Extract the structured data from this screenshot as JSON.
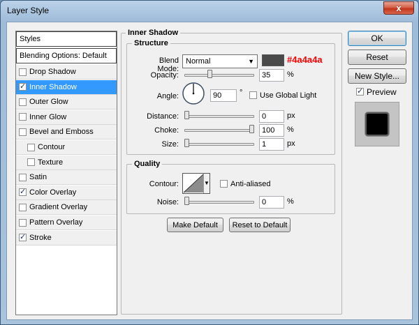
{
  "window": {
    "title": "Layer Style",
    "close_glyph": "x"
  },
  "styles_list": {
    "header": "Styles",
    "blending_options": "Blending Options: Default",
    "items": [
      {
        "label": "Drop Shadow",
        "checked": false,
        "selected": false,
        "indent": false
      },
      {
        "label": "Inner Shadow",
        "checked": true,
        "selected": true,
        "indent": false
      },
      {
        "label": "Outer Glow",
        "checked": false,
        "selected": false,
        "indent": false
      },
      {
        "label": "Inner Glow",
        "checked": false,
        "selected": false,
        "indent": false
      },
      {
        "label": "Bevel and Emboss",
        "checked": false,
        "selected": false,
        "indent": false
      },
      {
        "label": "Contour",
        "checked": false,
        "selected": false,
        "indent": true
      },
      {
        "label": "Texture",
        "checked": false,
        "selected": false,
        "indent": true
      },
      {
        "label": "Satin",
        "checked": false,
        "selected": false,
        "indent": false
      },
      {
        "label": "Color Overlay",
        "checked": true,
        "selected": false,
        "indent": false
      },
      {
        "label": "Gradient Overlay",
        "checked": false,
        "selected": false,
        "indent": false
      },
      {
        "label": "Pattern Overlay",
        "checked": false,
        "selected": false,
        "indent": false
      },
      {
        "label": "Stroke",
        "checked": true,
        "selected": false,
        "indent": false
      }
    ]
  },
  "inner_shadow": {
    "title": "Inner Shadow",
    "structure": {
      "title": "Structure",
      "blend_mode_label": "Blend Mode:",
      "blend_mode_value": "Normal",
      "color_swatch": "#4a4a4a",
      "color_annotation": "#4a4a4a",
      "opacity_label": "Opacity:",
      "opacity_value": "35",
      "opacity_fraction": 0.35,
      "opacity_unit": "%",
      "angle_label": "Angle:",
      "angle_value": "90",
      "angle_unit": "°",
      "use_global_light_label": "Use Global Light",
      "use_global_light_checked": false,
      "distance_label": "Distance:",
      "distance_value": "0",
      "distance_fraction": 0,
      "distance_unit": "px",
      "choke_label": "Choke:",
      "choke_value": "100",
      "choke_fraction": 1.0,
      "choke_unit": "%",
      "size_label": "Size:",
      "size_value": "1",
      "size_fraction": 0.005,
      "size_unit": "px"
    },
    "quality": {
      "title": "Quality",
      "contour_label": "Contour:",
      "anti_aliased_label": "Anti-aliased",
      "anti_aliased_checked": false,
      "noise_label": "Noise:",
      "noise_value": "0",
      "noise_fraction": 0,
      "noise_unit": "%"
    },
    "make_default_label": "Make Default",
    "reset_to_default_label": "Reset to Default"
  },
  "side_buttons": {
    "ok_label": "OK",
    "reset_label": "Reset",
    "new_style_label": "New Style...",
    "preview_label": "Preview",
    "preview_checked": true
  },
  "colors": {
    "selection": "#3399ff",
    "annotation_red": "#ff0000",
    "swatch": "#4a4a4a"
  }
}
